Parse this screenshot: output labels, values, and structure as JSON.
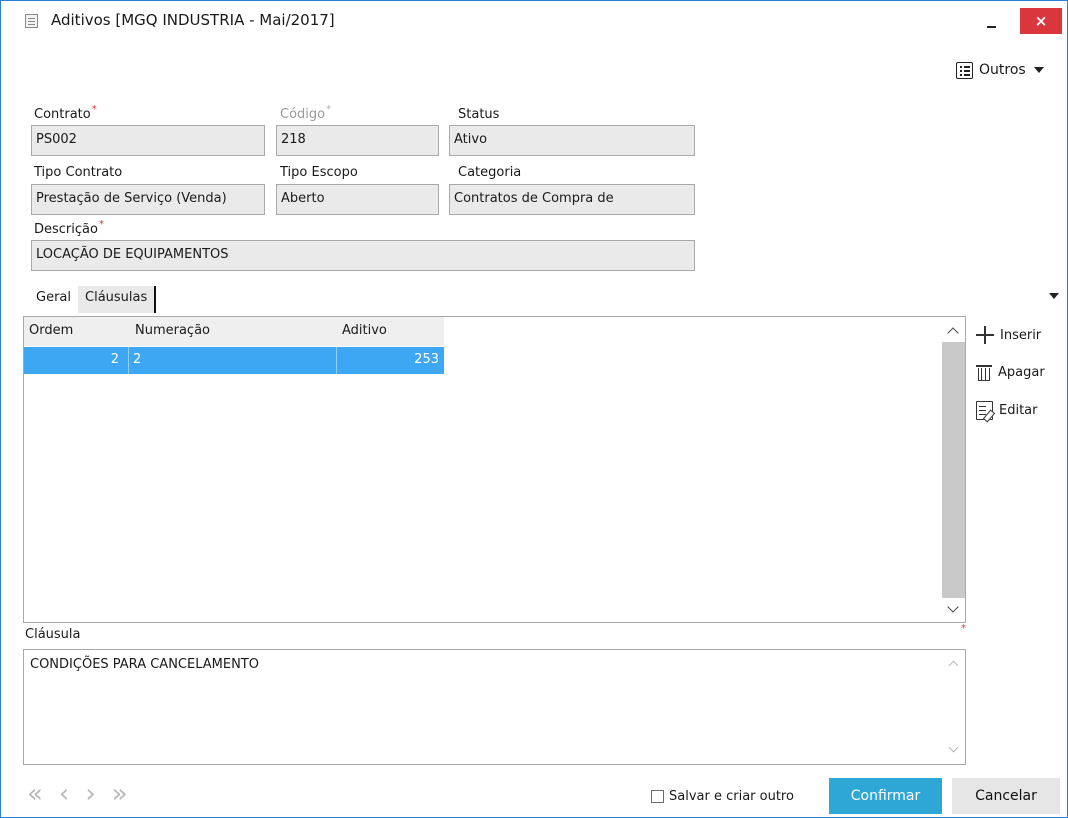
{
  "window": {
    "title": "Aditivos [MGQ INDUSTRIA - Mai/2017]",
    "close_glyph": "×"
  },
  "toolbar": {
    "outros_label": "Outros"
  },
  "form": {
    "contrato": {
      "label": "Contrato",
      "value": "PS002",
      "required": true
    },
    "codigo": {
      "label": "Código",
      "value": "218",
      "required": true
    },
    "status": {
      "label": "Status",
      "value": "Ativo"
    },
    "tipo_contrato": {
      "label": "Tipo Contrato",
      "value": "Prestação de Serviço (Venda)"
    },
    "tipo_escopo": {
      "label": "Tipo Escopo",
      "value": "Aberto"
    },
    "categoria": {
      "label": "Categoria",
      "value": "Contratos de Compra de"
    },
    "descricao": {
      "label": "Descrição",
      "value": "LOCAÇÃO DE EQUIPAMENTOS",
      "required": true
    }
  },
  "tabs": [
    {
      "label": "Geral",
      "active": false
    },
    {
      "label": "Cláusulas",
      "active": true
    }
  ],
  "grid": {
    "columns": [
      "Ordem",
      "Numeração",
      "Aditivo"
    ],
    "rows": [
      {
        "ordem": "2",
        "numeracao": "2",
        "aditivo": "253",
        "selected": true
      }
    ]
  },
  "side_actions": {
    "inserir": "Inserir",
    "apagar": "Apagar",
    "editar": "Editar"
  },
  "clausula": {
    "label": "Cláusula",
    "text": "CONDIÇÕES PARA CANCELAMENTO"
  },
  "footer": {
    "nav": [
      "«",
      "‹",
      "›",
      "»"
    ],
    "salvar_criar_outro": "Salvar e criar outro",
    "confirmar": "Confirmar",
    "cancelar": "Cancelar"
  },
  "colors": {
    "selection": "#3ea7f4",
    "confirm": "#2ea6d6",
    "close": "#d9363e",
    "required": "#d9363e"
  }
}
